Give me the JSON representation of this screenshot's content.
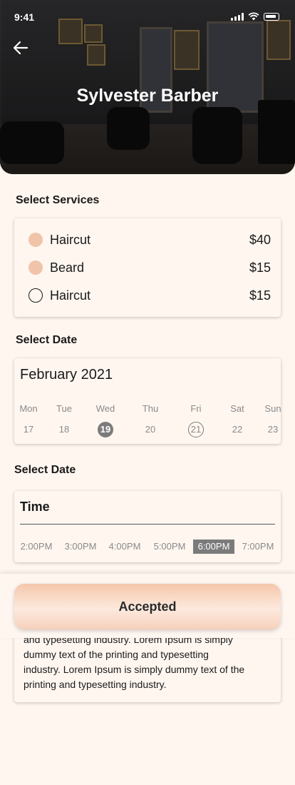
{
  "status_bar": {
    "time": "9:41"
  },
  "header": {
    "title": "Sylvester Barber"
  },
  "services": {
    "section_title": "Select Services",
    "items": [
      {
        "name": "Haircut",
        "price": "$40",
        "selected": true
      },
      {
        "name": "Beard",
        "price": "$15",
        "selected": true
      },
      {
        "name": "Haircut",
        "price": "$15",
        "selected": false
      }
    ]
  },
  "date": {
    "section_title": "Select Date",
    "month": "February 2021",
    "days": [
      {
        "day": "Mon",
        "date": "17",
        "state": "normal"
      },
      {
        "day": "Tue",
        "date": "18",
        "state": "normal"
      },
      {
        "day": "Wed",
        "date": "19",
        "state": "selected"
      },
      {
        "day": "Thu",
        "date": "20",
        "state": "normal"
      },
      {
        "day": "Fri",
        "date": "21",
        "state": "outlined"
      },
      {
        "day": "Sat",
        "date": "22",
        "state": "normal"
      },
      {
        "day": "Sun",
        "date": "23",
        "state": "normal"
      }
    ]
  },
  "time": {
    "section_title": "Select Date",
    "label": "Time",
    "slots": [
      "2:00PM",
      "3:00PM",
      "4:00PM",
      "5:00PM",
      "6:00PM",
      "7:00PM"
    ],
    "selected_slot": "6:00PM"
  },
  "action": {
    "accept_label": "Accepted"
  },
  "description": {
    "lines": [
      "and typesetting industry. Lorem Ipsum is simply",
      "dummy text of the printing and typesetting",
      "industry. Lorem Ipsum is simply dummy text of the",
      "printing and typesetting industry."
    ]
  },
  "colors": {
    "background": "#fff6f0",
    "accent": "#f0c4a8",
    "selected_gray": "#7b7b7b"
  }
}
